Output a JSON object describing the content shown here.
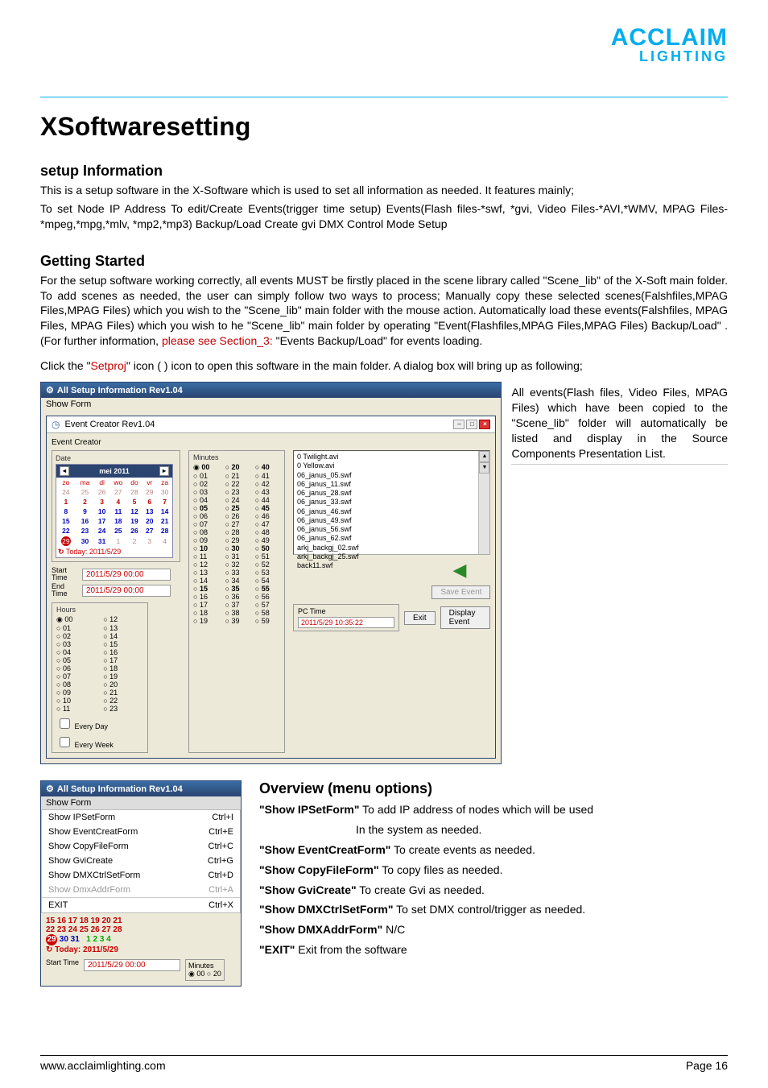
{
  "logo": {
    "main": "ACCLAIM",
    "sub": "LIGHTING"
  },
  "title": "XSoftwaresetting",
  "setup": {
    "heading": "setup Information",
    "intro1": "This is a setup software in the X-Software which is used to set all information as needed. It features mainly;",
    "intro2": "To set Node IP Address To edit/Create Events(trigger time setup) Events(Flash files-*swf, *gvi, Video Files-*AVI,*WMV, MPAG Files-*mpeg,*mpg,*mlv, *mp2,*mp3) Backup/Load Create gvi DMX Control Mode Setup"
  },
  "getting_started": {
    "heading": "Getting Started",
    "para1a": "For the setup software working correctly, all events MUST be firstly placed in the scene library called \"Scene_lib\" of the X-Soft main folder. To add scenes as needed, the user can simply follow two ways to process; Manually copy these selected scenes(Falshfiles,MPAG Files,MPAG Files) which you wish to the \"Scene_lib\" main folder with the mouse action. Automatically load these events(Falshfiles, MPAG Files, MPAG Files) which you wish to he \"Scene_lib\" main folder by operating \"Event(Flashfiles,MPAG Files,MPAG Files) Backup/Load\" . (For further information, ",
    "para1link": "please see Section_3:",
    "para1b": " \"Events Backup/Load\" for events loading.",
    "para2a": "Click the \"",
    "para2red": "Setproj",
    "para2b": "\" icon ( ) icon to open this software in the main folder. A dialog box will bring up as following;"
  },
  "shot1": {
    "outerTitle": "All Setup Information Rev1.04",
    "menubar": "Show Form",
    "innerTitle": "Event Creator Rev1.04",
    "dateLabel": "Date",
    "calendar": {
      "month": "mei 2011",
      "dow": [
        "zo",
        "ma",
        "di",
        "wo",
        "do",
        "vr",
        "za"
      ],
      "rows": [
        [
          "24",
          "25",
          "26",
          "27",
          "28",
          "29",
          "30"
        ],
        [
          "1",
          "2",
          "3",
          "4",
          "5",
          "6",
          "7"
        ],
        [
          "8",
          "9",
          "10",
          "11",
          "12",
          "13",
          "14"
        ],
        [
          "15",
          "16",
          "17",
          "18",
          "19",
          "20",
          "21"
        ],
        [
          "22",
          "23",
          "24",
          "25",
          "26",
          "27",
          "28"
        ],
        [
          "29",
          "30",
          "31",
          "1",
          "2",
          "3",
          "4"
        ]
      ],
      "today": "Today: 2011/5/29"
    },
    "startLabel": "Start Time",
    "startVal": "2011/5/29 00:00",
    "endLabel": "End Time",
    "endVal": "2011/5/29 00:00",
    "hoursLabel": "Hours",
    "evDay": "Every Day",
    "evWeek": "Every Week",
    "minutesLabel": "Minutes",
    "files": [
      "0 Twilight.avi",
      "0 Yellow.avi",
      "06_janus_05.swf",
      "06_janus_11.swf",
      "06_janus_28.swf",
      "06_janus_33.swf",
      "06_janus_46.swf",
      "06_janus_49.swf",
      "06_janus_56.swf",
      "06_janus_62.swf",
      "arkj_backgj_02.swf",
      "arkj_backgj_25.swf",
      "back11.swf"
    ],
    "saveBtn": "Save Event",
    "displayBtn": "Display Event",
    "exitBtn": "Exit",
    "pctimeLabel": "PC Time",
    "pctimeVal": "2011/5/29 10:35:22",
    "sideNote": "All events(Flash files, Video Files, MPAG Files) which have been copied to the \"Scene_lib\" folder will automatically be listed and display in the Source Components Presentation List."
  },
  "shot2": {
    "title": "All Setup Information Rev1.04",
    "menubar": "Show Form",
    "items": [
      {
        "l": "Show IPSetForm",
        "k": "Ctrl+I"
      },
      {
        "l": "Show EventCreatForm",
        "k": "Ctrl+E"
      },
      {
        "l": "Show CopyFileForm",
        "k": "Ctrl+C"
      },
      {
        "l": "Show GviCreate",
        "k": "Ctrl+G"
      },
      {
        "l": "Show DMXCtrlSetForm",
        "k": "Ctrl+D"
      },
      {
        "l": "Show DmxAddrForm",
        "k": "Ctrl+A",
        "disabled": true
      },
      {
        "l": "EXIT",
        "k": "Ctrl+X"
      }
    ],
    "cal": {
      "r1": "15  16  17  18  19  20  21",
      "r2": "22  23  24  25  26  27  28",
      "r3a": "29",
      "r3b": "30  31",
      "r3c": "1   2   3   4",
      "today": "Today: 2011/5/29"
    },
    "startLabel": "Start Time",
    "startVal": "2011/5/29 00:00",
    "minLabel": "Minutes",
    "minOpt": "00   ○ 20"
  },
  "overview": {
    "heading": "Overview",
    "sub": " (menu options)",
    "items": [
      {
        "t": "\"Show IPSetForm\"",
        "d": "  To add IP address of nodes which will be used",
        "d2": "In the system as needed."
      },
      {
        "t": " \"Show EventCreatForm\"",
        "d": "  To create events as needed."
      },
      {
        "t": "\"Show CopyFileForm\"",
        "d": "  To copy files as needed."
      },
      {
        "t": "\"Show GviCreate\"",
        "d": "  To create Gvi as needed."
      },
      {
        "t": "\"Show DMXCtrlSetForm\"",
        "d": "  To set DMX control/trigger as needed."
      },
      {
        "t": "\"Show DMXAddrForm\"",
        "d": "  N/C"
      },
      {
        "t": "\"EXIT\"",
        "d": "  Exit from the software"
      }
    ]
  },
  "footer": {
    "url": "www.acclaimlighting.com",
    "page": "Page 16"
  }
}
